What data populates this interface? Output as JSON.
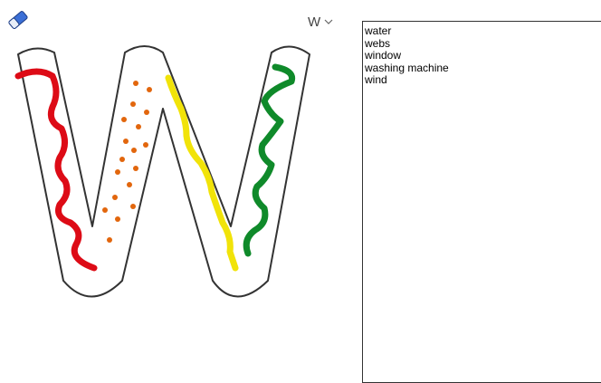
{
  "toolbar": {
    "eraser_icon": "eraser-icon",
    "letter_selected": "W",
    "dropdown_icon": "chevron-down-icon"
  },
  "canvas": {
    "letter": "W",
    "outline_color": "#333333",
    "stroke_colors": {
      "red": "#dd0b16",
      "orange_dots": "#e2660d",
      "yellow": "#f1e309",
      "green": "#0f8a2a"
    }
  },
  "word_list": {
    "items": [
      "water",
      "webs",
      "window",
      "washing machine",
      "wind"
    ]
  }
}
